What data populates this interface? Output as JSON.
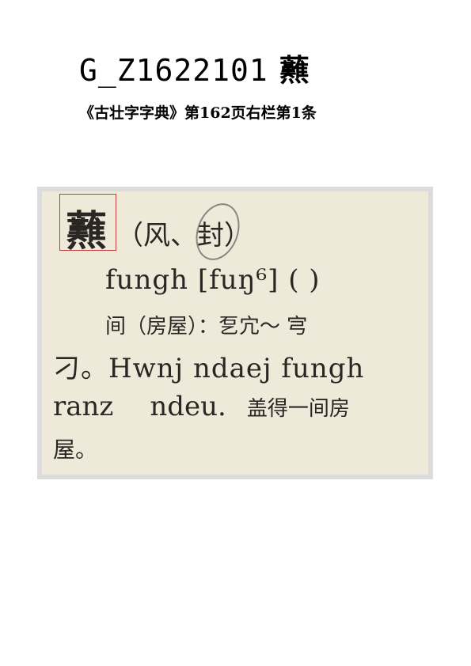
{
  "header": {
    "code": "G_Z1622101",
    "character": "䖄",
    "source": "《古壮字字典》第162页右栏第1条"
  },
  "scan": {
    "headword": "䖄",
    "components": "（风、封）",
    "romanization": "fungh [fuŋ⁶]  (    )",
    "definition": "间（房屋）：乭宂～ 宆",
    "example_line1": "刁。Hwnj ndaej fungh",
    "example_line2_a": "ranz",
    "example_line2_b": "ndeu.",
    "translation_a": "盖得一间房",
    "translation_b": "屋。"
  }
}
